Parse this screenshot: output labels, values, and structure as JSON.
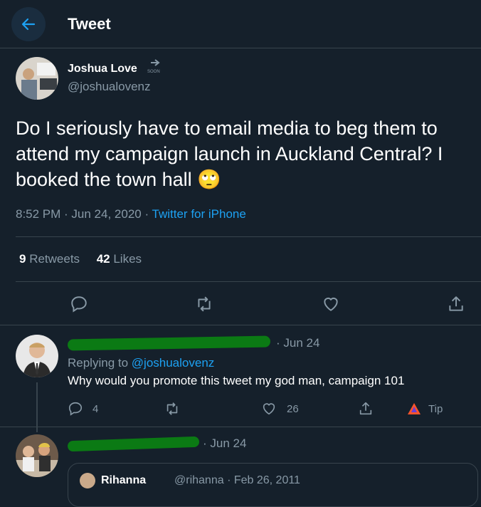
{
  "header": {
    "title": "Tweet"
  },
  "tweet": {
    "author_name": "Joshua Love",
    "handle": "@joshualovenz",
    "text": "Do I seriously have to email media to beg them to attend my campaign launch in Auckland Central? I booked the town hall",
    "emoji": "🙄",
    "timestamp": "8:52 PM · Jun 24, 2020 · ",
    "source": "Twitter for iPhone",
    "badge_text": "SOON"
  },
  "stats": {
    "retweets_count": "9",
    "retweets_label": " Retweets",
    "likes_count": "42",
    "likes_label": " Likes"
  },
  "replies": [
    {
      "date": "· Jun 24",
      "replying_prefix": "Replying to ",
      "replying_handle": "@joshualovenz",
      "text": "Why would you promote this tweet my god man, campaign 101",
      "reply_count": "4",
      "like_count": "26",
      "tip_label": "Tip"
    },
    {
      "date": "· Jun 24",
      "quote_name": "Rihanna",
      "quote_handle": "@rihanna · Feb 26, 2011"
    }
  ],
  "colors": {
    "background": "#15202b",
    "accent": "#1da1f2",
    "muted": "#8899a6",
    "divider": "#38444d",
    "redaction": "#0b7a14"
  },
  "icons": [
    "back-arrow-icon",
    "reply-icon",
    "retweet-icon",
    "like-icon",
    "share-icon",
    "tip-icon"
  ]
}
